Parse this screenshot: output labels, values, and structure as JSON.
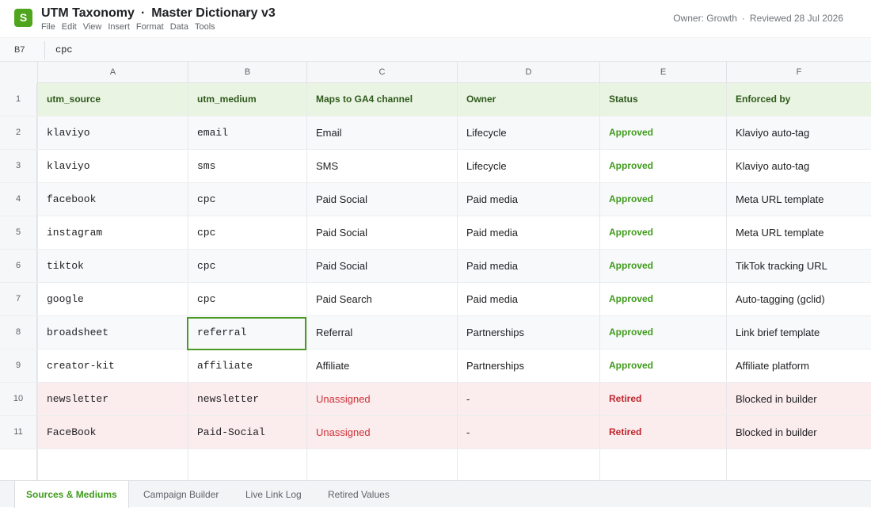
{
  "app": {
    "logo_letter": "S",
    "title": "UTM Taxonomy",
    "title_sep": "·",
    "subtitle": "Master Dictionary v3",
    "menu": [
      "File",
      "Edit",
      "View",
      "Insert",
      "Format",
      "Data",
      "Tools"
    ],
    "owner": "Owner: Growth",
    "meta_sep": "·",
    "reviewed": "Reviewed 28 Jul 2026",
    "accent": "#4fa51e"
  },
  "formula_bar": {
    "cell_ref": "B7",
    "value": "cpc"
  },
  "columns": [
    "A",
    "B",
    "C",
    "D",
    "E",
    "F"
  ],
  "header_row": {
    "num": "1",
    "cells": [
      "utm_source",
      "utm_medium",
      "Maps to GA4 channel",
      "Owner",
      "Status",
      "Enforced by"
    ]
  },
  "rows": [
    {
      "num": "2",
      "source": "klaviyo",
      "medium": "email",
      "channel": "Email",
      "owner": "Lifecycle",
      "status": "Approved",
      "enforced": "Klaviyo auto-tag"
    },
    {
      "num": "3",
      "source": "klaviyo",
      "medium": "sms",
      "channel": "SMS",
      "owner": "Lifecycle",
      "status": "Approved",
      "enforced": "Klaviyo auto-tag"
    },
    {
      "num": "4",
      "source": "facebook",
      "medium": "cpc",
      "channel": "Paid Social",
      "owner": "Paid media",
      "status": "Approved",
      "enforced": "Meta URL template"
    },
    {
      "num": "5",
      "source": "instagram",
      "medium": "cpc",
      "channel": "Paid Social",
      "owner": "Paid media",
      "status": "Approved",
      "enforced": "Meta URL template"
    },
    {
      "num": "6",
      "source": "tiktok",
      "medium": "cpc",
      "channel": "Paid Social",
      "owner": "Paid media",
      "status": "Approved",
      "enforced": "TikTok tracking URL"
    },
    {
      "num": "7",
      "source": "google",
      "medium": "cpc",
      "channel": "Paid Search",
      "owner": "Paid media",
      "status": "Approved",
      "enforced": "Auto-tagging (gclid)"
    },
    {
      "num": "8",
      "source": "broadsheet",
      "medium": "referral",
      "channel": "Referral",
      "owner": "Partnerships",
      "status": "Approved",
      "enforced": "Link brief template"
    },
    {
      "num": "9",
      "source": "creator-kit",
      "medium": "affiliate",
      "channel": "Affiliate",
      "owner": "Partnerships",
      "status": "Approved",
      "enforced": "Affiliate platform"
    },
    {
      "num": "10",
      "source": "newsletter",
      "medium": "newsletter",
      "channel": "Unassigned",
      "owner": "-",
      "status": "Retired",
      "enforced": "Blocked in builder"
    },
    {
      "num": "11",
      "source": "FaceBook",
      "medium": "Paid-Social",
      "channel": "Unassigned",
      "owner": "-",
      "status": "Retired",
      "enforced": "Blocked in builder"
    }
  ],
  "sheet_tabs": [
    {
      "label": "Sources & Mediums",
      "active": true
    },
    {
      "label": "Campaign Builder",
      "active": false
    },
    {
      "label": "Live Link Log",
      "active": false
    },
    {
      "label": "Retired Values",
      "active": false
    }
  ],
  "colors": {
    "approved": "#3f9b1c",
    "retired": "#c0262d",
    "header_row_bg": "#eaf4e3",
    "retired_row_bg": "#fbeced",
    "selection": "#4b9a22"
  }
}
